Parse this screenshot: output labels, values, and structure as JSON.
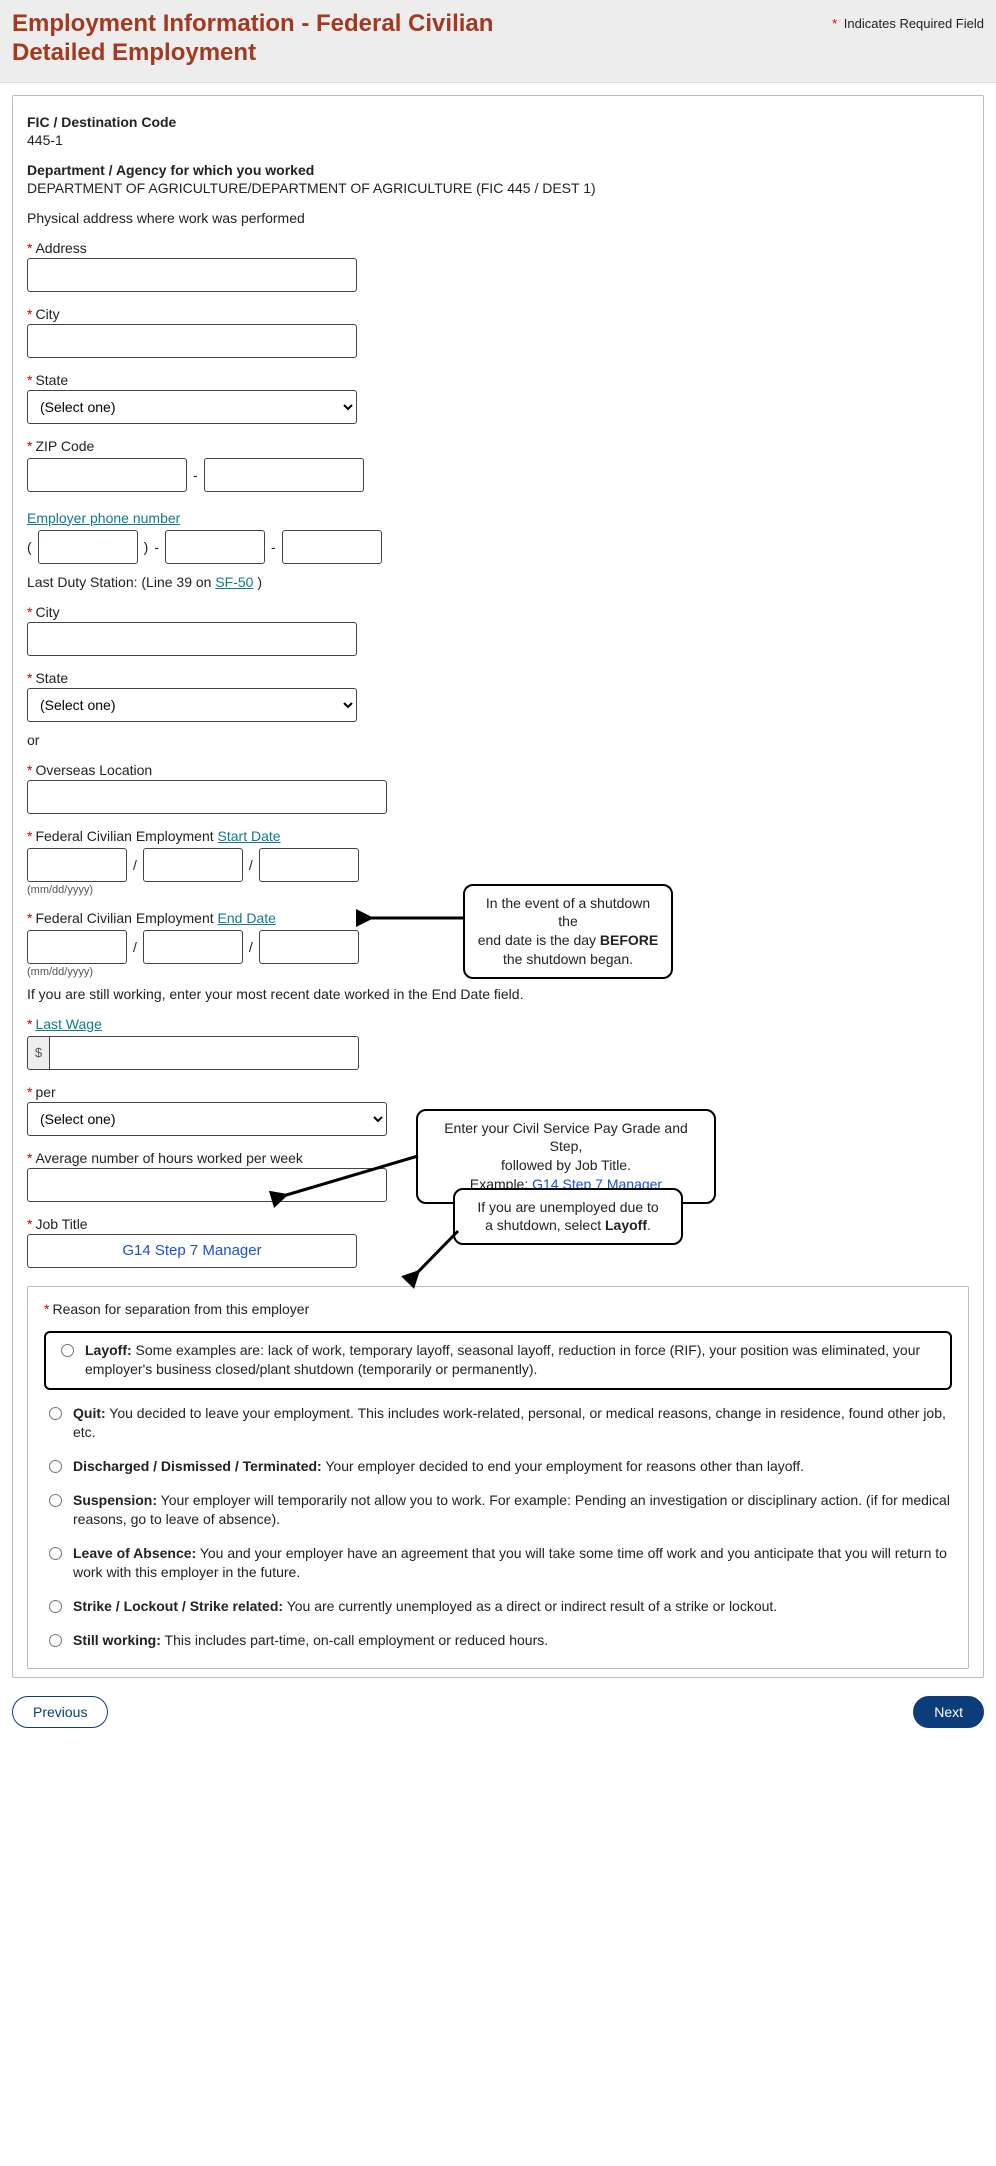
{
  "header": {
    "title": "Employment Information - Federal Civilian Detailed Employment",
    "required_note_star": "*",
    "required_note": " Indicates Required Field"
  },
  "fic": {
    "label": "FIC / Destination Code",
    "value": "445-1"
  },
  "dept": {
    "label": "Department / Agency for which you worked",
    "value": "DEPARTMENT OF AGRICULTURE/DEPARTMENT OF AGRICULTURE (FIC 445 / DEST 1)"
  },
  "phys_label": "Physical address where work was performed",
  "fields": {
    "address_label": "Address",
    "city_label": "City",
    "state_label": "State",
    "zip_label": "ZIP Code",
    "employer_phone_link": "Employer phone number",
    "last_duty_prefix": "Last Duty Station: (Line 39 on ",
    "sf50_link": "SF-50",
    "last_duty_suffix": " )",
    "ds_city_label": "City",
    "ds_state_label": "State",
    "or": "or",
    "overseas_label": "Overseas Location",
    "start_prefix": "Federal Civilian Employment ",
    "start_link": "Start Date",
    "end_prefix": "Federal Civilian Employment ",
    "end_link": "End Date",
    "date_hint": "(mm/dd/yyyy)",
    "still_working_note": "If you are still working, enter your most recent date worked in the End Date field.",
    "last_wage_link": "Last Wage",
    "dollar": "$",
    "per_label": "per",
    "avg_hours_label": "Average number of hours worked per week",
    "job_title_label": "Job Title",
    "job_title_value": "G14 Step 7 Manager",
    "select_one": "(Select one)"
  },
  "reason": {
    "heading": "Reason for separation from this employer",
    "options": {
      "layoff_b": "Layoff:",
      "layoff_t": " Some examples are: lack of work, temporary layoff, seasonal layoff, reduction in force (RIF), your position was eliminated, your employer's business closed/plant shutdown (temporarily or permanently).",
      "quit_b": "Quit:",
      "quit_t": " You decided to leave your employment. This includes work-related, personal, or medical reasons, change in residence, found other job, etc.",
      "disch_b": "Discharged / Dismissed / Terminated:",
      "disch_t": " Your employer decided to end your employment for reasons other than layoff.",
      "susp_b": "Suspension:",
      "susp_t": " Your employer will temporarily not allow you to work. For example: Pending an investigation or disciplinary action. (if for medical reasons, go to leave of absence).",
      "loa_b": "Leave of Absence:",
      "loa_t": " You and your employer have an agreement that you will take some time off work and you anticipate that you will return to work with this employer in the future.",
      "strike_b": "Strike / Lockout / Strike related:",
      "strike_t": " You are currently unemployed as a direct or indirect result of a strike or lockout.",
      "still_b": "Still working:",
      "still_t": " This includes part-time, on-call employment or reduced hours."
    }
  },
  "buttons": {
    "previous": "Previous",
    "next": "Next"
  },
  "annotations": {
    "end_date_l1": "In the event of a shutdown the",
    "end_date_l2a": "end date is the day ",
    "end_date_l2b": "BEFORE",
    "end_date_l3": "the shutdown began.",
    "job_l1": "Enter your Civil Service Pay Grade and Step,",
    "job_l2": "followed by Job Title.",
    "job_l3a": "Example: ",
    "job_l3b": "G14 Step 7 Manager",
    "layoff_l1": "If you are unemployed due to",
    "layoff_l2a": "a shutdown, select ",
    "layoff_l2b": "Layoff",
    "layoff_l2c": "."
  }
}
